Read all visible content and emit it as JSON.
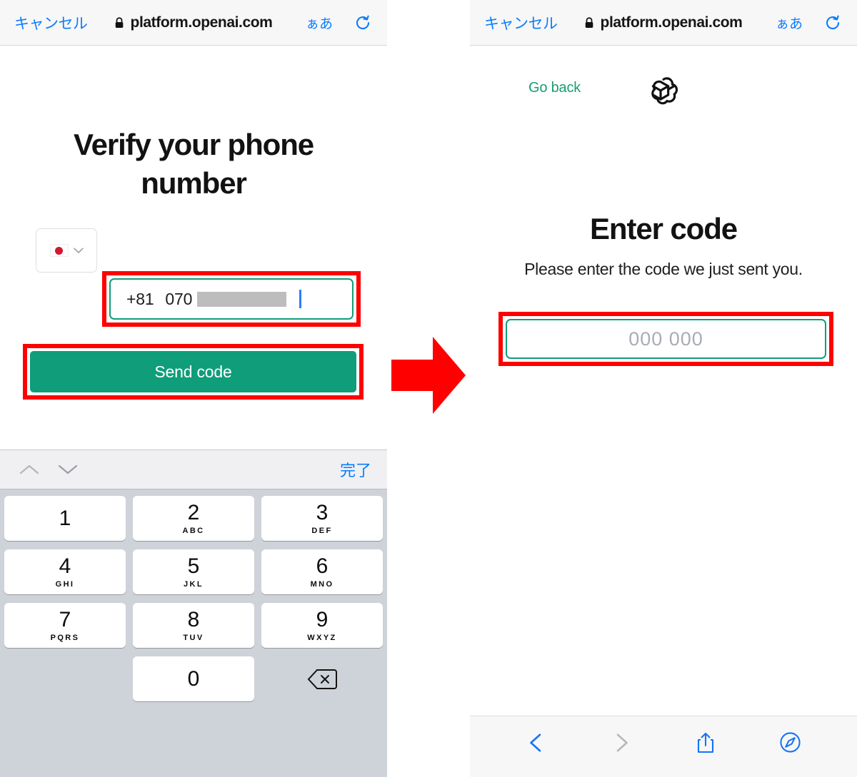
{
  "browser": {
    "cancel_label": "キャンセル",
    "url": "platform.openai.com",
    "lock_icon": "lock-icon",
    "text_size_label": "ぁあ",
    "reload_icon": "reload-icon"
  },
  "left_screen": {
    "title": "Verify your phone number",
    "country_selector": {
      "flag": "jp-flag-icon",
      "chevron": "chevron-down-icon"
    },
    "phone_field": {
      "country_code": "+81",
      "prefix": "070",
      "redacted": true
    },
    "send_button_label": "Send code",
    "keyboard": {
      "done_label": "完了",
      "up_icon": "chevron-up-icon",
      "down_icon": "chevron-down-icon",
      "keys": [
        {
          "num": "1",
          "sub": ""
        },
        {
          "num": "2",
          "sub": "ABC"
        },
        {
          "num": "3",
          "sub": "DEF"
        },
        {
          "num": "4",
          "sub": "GHI"
        },
        {
          "num": "5",
          "sub": "JKL"
        },
        {
          "num": "6",
          "sub": "MNO"
        },
        {
          "num": "7",
          "sub": "PQRS"
        },
        {
          "num": "8",
          "sub": "TUV"
        },
        {
          "num": "9",
          "sub": "WXYZ"
        },
        {
          "num": "0",
          "sub": ""
        }
      ],
      "backspace_icon": "backspace-icon"
    }
  },
  "right_screen": {
    "go_back_label": "Go back",
    "logo": "openai-logo-icon",
    "title": "Enter code",
    "subtitle": "Please enter the code we just sent you.",
    "code_placeholder": "000 000",
    "toolbar": {
      "back_icon": "chevron-left-icon",
      "forward_icon": "chevron-right-icon",
      "share_icon": "share-icon",
      "tabs_icon": "compass-icon"
    }
  },
  "annotation": {
    "arrow": "right-arrow-icon",
    "highlight_color": "#ff0000"
  },
  "colors": {
    "accent_green": "#0f9d7a",
    "link_blue": "#0a7cff",
    "highlight_red": "#ff0000",
    "keyboard_bg": "#ced2d9"
  }
}
